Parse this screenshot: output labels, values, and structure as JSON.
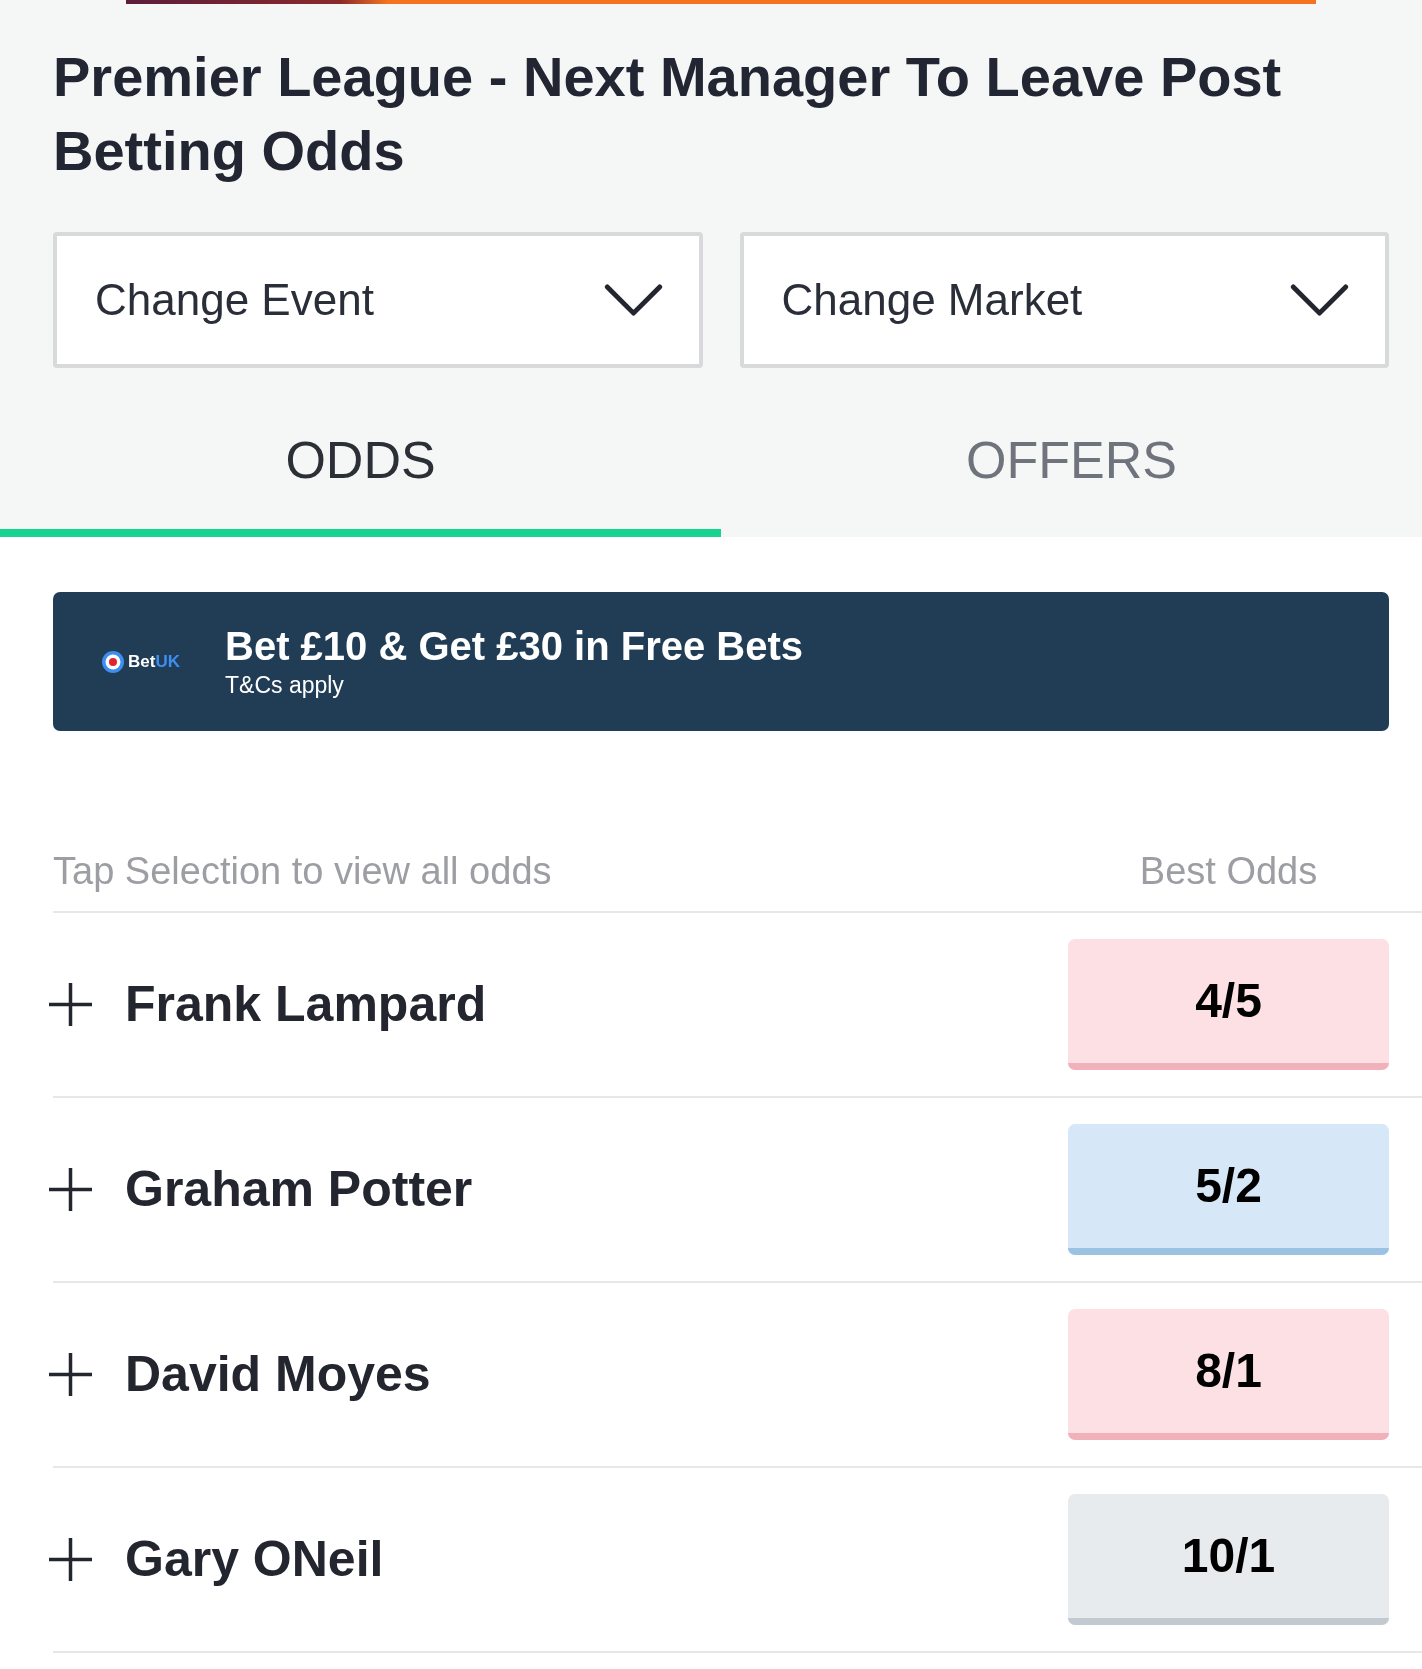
{
  "page_title": "Premier League - Next Manager To Leave Post Betting Odds",
  "dropdowns": [
    {
      "label": "Change Event"
    },
    {
      "label": "Change Market"
    }
  ],
  "tabs": [
    {
      "label": "ODDS",
      "selected": true
    },
    {
      "label": "OFFERS",
      "selected": false
    }
  ],
  "promo": {
    "brand": {
      "name": "Bet",
      "accent": "UK"
    },
    "headline": "Bet £10 & Get £30 in Free Bets",
    "terms": "T&Cs apply"
  },
  "odds_table": {
    "hint": "Tap Selection to view all odds",
    "column_header": "Best Odds",
    "rows": [
      {
        "name": "Frank Lampard",
        "expanded": false,
        "odds": "4/5",
        "color": "#fde0e4"
      },
      {
        "name": "Graham Potter",
        "expanded": false,
        "odds": "5/2",
        "color": "#d6e8f7"
      },
      {
        "name": "David Moyes",
        "expanded": false,
        "odds": "8/1",
        "color": "#fde0e4"
      },
      {
        "name": "Gary ONeil",
        "expanded": false,
        "odds": "10/1",
        "color": "#e8ebee"
      }
    ]
  }
}
